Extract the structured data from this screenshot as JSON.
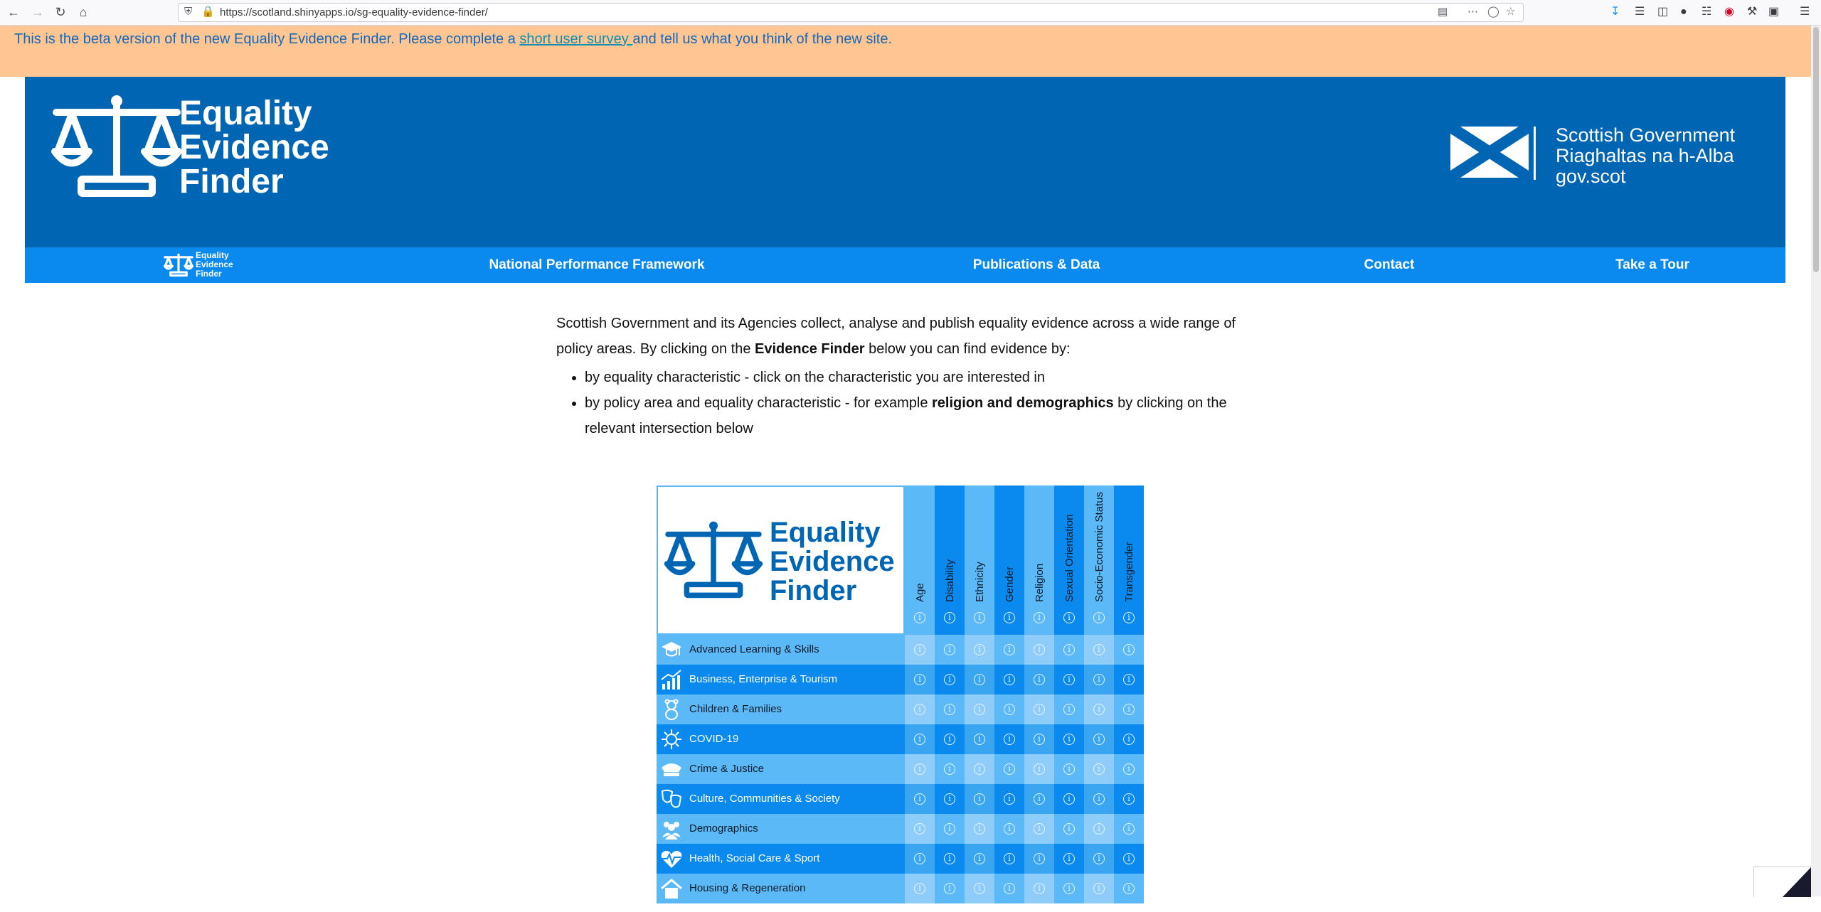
{
  "browser": {
    "url": "https://scotland.shinyapps.io/sg-equality-evidence-finder/",
    "back_icon": "back-arrow-icon",
    "forward_icon": "forward-arrow-icon",
    "reload_icon": "reload-icon",
    "home_icon": "home-icon"
  },
  "banner": {
    "text_before": "This is the beta version of the new Equality Evidence Finder. Please complete a ",
    "link_text": "short user survey ",
    "text_after": "and tell us what you think of the new site.",
    "bg_color": "#ffc694"
  },
  "header": {
    "logo_line1": "Equality",
    "logo_line2": "Evidence",
    "logo_line3": "Finder",
    "gov_line1": "Scottish Government",
    "gov_line2": "Riaghaltas na h-Alba",
    "gov_line3": "gov.scot",
    "bg_color": "#0065b3"
  },
  "nav": {
    "logo_line1": "Equality",
    "logo_line2": "Evidence",
    "logo_line3": "Finder",
    "items": [
      {
        "label": "National Performance Framework"
      },
      {
        "label": "Publications & Data"
      },
      {
        "label": "Contact"
      },
      {
        "label": "Take a Tour"
      }
    ],
    "bg_color": "#0a8aee"
  },
  "intro": {
    "p1_before": "Scottish Government and its Agencies collect, analyse and publish equality evidence across a wide range of policy areas. By clicking on the ",
    "p1_bold": "Evidence Finder",
    "p1_after": " below you can find evidence by:",
    "bullet1": "by equality characteristic - click on the characteristic you are interested in",
    "bullet2_before": "by policy area and equality characteristic - for example ",
    "bullet2_bold": "religion and demographics",
    "bullet2_after": " by clicking on the relevant intersection below"
  },
  "grid": {
    "logo_line1": "Equality",
    "logo_line2": "Evidence",
    "logo_line3": "Finder",
    "info_glyph": "i",
    "columns": [
      "Age",
      "Disability",
      "Ethnicity",
      "Gender",
      "Religion",
      "Sexual Orientation",
      "Socio-Economic Status",
      "Transgender"
    ],
    "rows": [
      {
        "label": "Advanced Learning & Skills",
        "icon": "graduation-cap-icon"
      },
      {
        "label": "Business, Enterprise & Tourism",
        "icon": "growth-chart-icon"
      },
      {
        "label": "Children & Families",
        "icon": "teddy-bear-icon"
      },
      {
        "label": "COVID-19",
        "icon": "virus-icon"
      },
      {
        "label": "Crime & Justice",
        "icon": "police-hat-icon"
      },
      {
        "label": "Culture, Communities & Society",
        "icon": "theatre-masks-icon"
      },
      {
        "label": "Demographics",
        "icon": "people-group-icon"
      },
      {
        "label": "Health, Social Care & Sport",
        "icon": "heartbeat-icon"
      },
      {
        "label": "Housing & Regeneration",
        "icon": "house-icon"
      }
    ],
    "light_color": "#5cb9f8",
    "dark_color": "#0a8aee"
  }
}
